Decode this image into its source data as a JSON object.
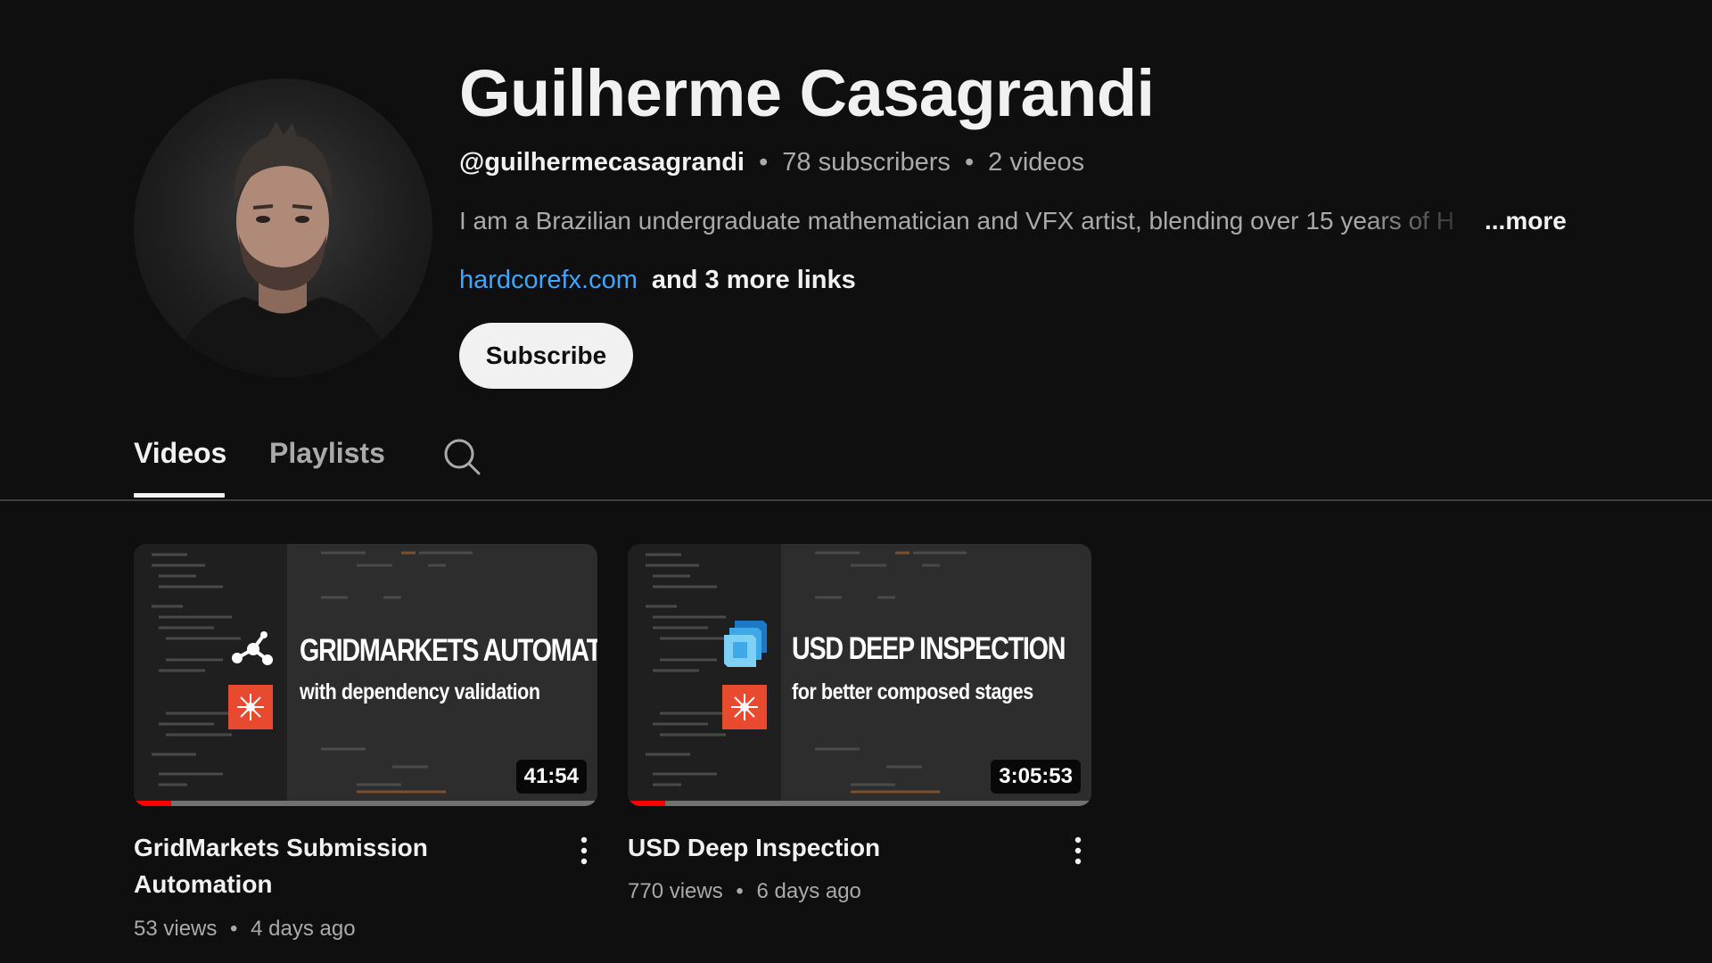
{
  "channel": {
    "name": "Guilherme Casagrandi",
    "handle": "@guilhermecasagrandi",
    "subscribers": "78 subscribers",
    "video_count": "2 videos",
    "separator": "•",
    "description": "I am a Brazilian undergraduate mathematician and VFX artist, blending over 15 years of H",
    "more_label": "...more",
    "link_main": "hardcorefx.com",
    "link_more": "and 3 more links",
    "subscribe_label": "Subscribe"
  },
  "tabs": [
    {
      "label": "Videos",
      "active": true
    },
    {
      "label": "Playlists",
      "active": false
    }
  ],
  "icons": {
    "search": "search-icon",
    "more_actions": "more-vert-icon"
  },
  "videos": [
    {
      "title": "GridMarkets Submission Automation",
      "views": "53 views",
      "age": "4 days ago",
      "duration": "41:54",
      "watched_fraction": 0.08,
      "thumb_headline": "GRIDMARKETS AUTOMATION",
      "thumb_subline": "with dependency validation",
      "thumb_icon": "node-graph-icon"
    },
    {
      "title": "USD Deep Inspection",
      "views": "770 views",
      "age": "6 days ago",
      "duration": "3:05:53",
      "watched_fraction": 0.08,
      "thumb_headline": "USD DEEP INSPECTION",
      "thumb_subline": "for better composed stages",
      "thumb_icon": "stacked-layers-icon"
    }
  ],
  "colors": {
    "background": "#0f0f0f",
    "link": "#3ea6ff",
    "accent_red": "#ff0000",
    "fx_orange": "#e84a2f",
    "usd_blue": "#3fa9e8"
  }
}
